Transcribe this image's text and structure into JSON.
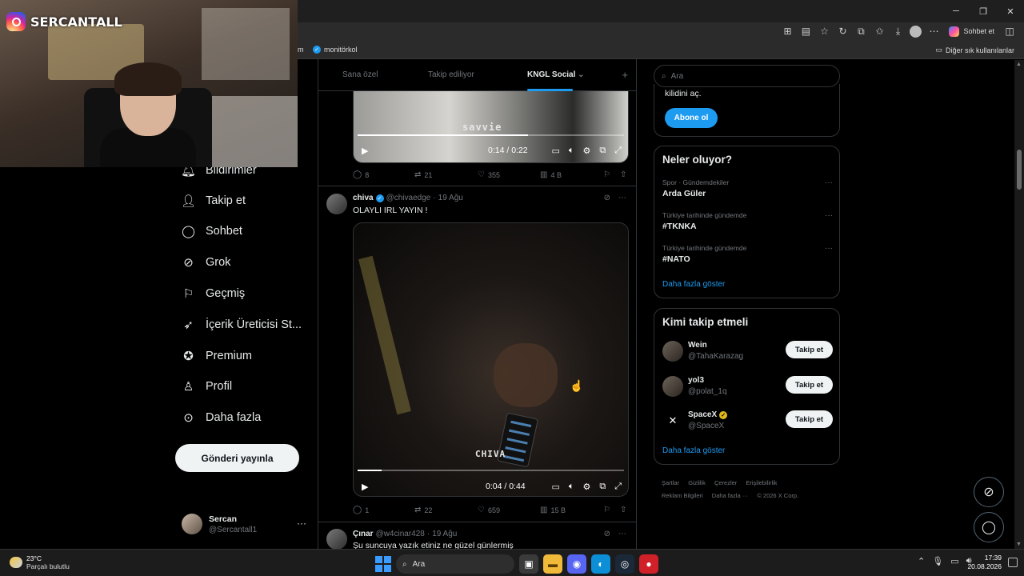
{
  "browser": {
    "favorites": [
      {
        "label": "m"
      },
      {
        "label": "monitörkol"
      }
    ],
    "chat_label": "Sohbet et",
    "other_favorites": "Diğer sık kullanılanlar",
    "window_controls": [
      "─",
      "❐",
      "✕"
    ]
  },
  "webcam": {
    "platform_icon": "instagram-icon",
    "channel_name": "SERCANTALL"
  },
  "nav": {
    "items": [
      {
        "label": "Bildirimler",
        "icon": "bell-icon"
      },
      {
        "label": "Takip et",
        "icon": "person-plus-icon"
      },
      {
        "label": "Sohbet",
        "icon": "chat-bubble-icon"
      },
      {
        "label": "Grok",
        "icon": "grok-icon"
      },
      {
        "label": "Geçmiş",
        "icon": "bookmark-icon"
      },
      {
        "label": "İçerik Üreticisi St...",
        "icon": "rocket-icon"
      },
      {
        "label": "Premium",
        "icon": "verified-badge-icon"
      },
      {
        "label": "Profil",
        "icon": "person-icon"
      },
      {
        "label": "Daha fazla",
        "icon": "more-circle-icon"
      }
    ],
    "post_button": "Gönderi yayınla",
    "profile": {
      "name": "Sercan",
      "handle": "@Sercantall1",
      "more": "···"
    }
  },
  "tabs": {
    "items": [
      "Sana özel",
      "Takip ediliyor",
      "KNGL Social"
    ],
    "active": "KNGL Social",
    "plus": "+"
  },
  "feed": {
    "post1": {
      "video": {
        "watermark": "savvie",
        "time": "0:14 / 0:22",
        "progress": 0.64
      },
      "stats": {
        "replies": "8",
        "reposts": "21",
        "likes": "355",
        "views": "4 B"
      }
    },
    "post2": {
      "name": "chiva",
      "handle": "@chivaedge",
      "date": "19 Ağu",
      "text": "OLAYLI IRL YAYIN !",
      "video": {
        "watermark": "CHIVA",
        "time": "0:04 / 0:44",
        "progress": 0.09
      },
      "stats": {
        "replies": "1",
        "reposts": "22",
        "likes": "659",
        "views": "15 B"
      }
    },
    "post3": {
      "name": "Çınar",
      "handle": "@w4cinar428",
      "date": "19 Ağu",
      "text": "Şu suncuya yazık etiniz ne güzel günlermiş"
    }
  },
  "right": {
    "search_placeholder": "Ara",
    "premium_text": "kilidini aç.",
    "subscribe_button": "Abone ol",
    "trends_title": "Neler oluyor?",
    "trends": [
      {
        "category": "Spor · Gündemdekiler",
        "name": "Arda Güler"
      },
      {
        "category": "Türkiye tarihinde gündemde",
        "name": "#TKNKA"
      },
      {
        "category": "Türkiye tarihinde gündemde",
        "name": "#NATO"
      }
    ],
    "trends_more": "Daha fazla göster",
    "who_title": "Kimi takip etmeli",
    "who": [
      {
        "name": "Wein",
        "handle": "@TahaKarazag",
        "button": "Takip et"
      },
      {
        "name": "yol3",
        "handle": "@polat_1q",
        "button": "Takip et"
      },
      {
        "name": "SpaceX",
        "handle": "@SpaceX",
        "button": "Takip et"
      }
    ],
    "who_more": "Daha fazla göster",
    "footer": [
      "Şartlar",
      "Gizlilik",
      "Çerezler",
      "Erişilebilirlik",
      "Reklam Bilgileri",
      "Daha fazla ···",
      "© 2026 X Corp."
    ]
  },
  "taskbar": {
    "weather_temp": "23°C",
    "weather_desc": "Parçalı bulutlu",
    "search_label": "Ara",
    "time": "17:39",
    "date": "20.08.2026"
  },
  "colors": {
    "accent": "#1d9bf0",
    "background": "#000000",
    "border": "#2f3336",
    "muted_text": "#71767b"
  }
}
